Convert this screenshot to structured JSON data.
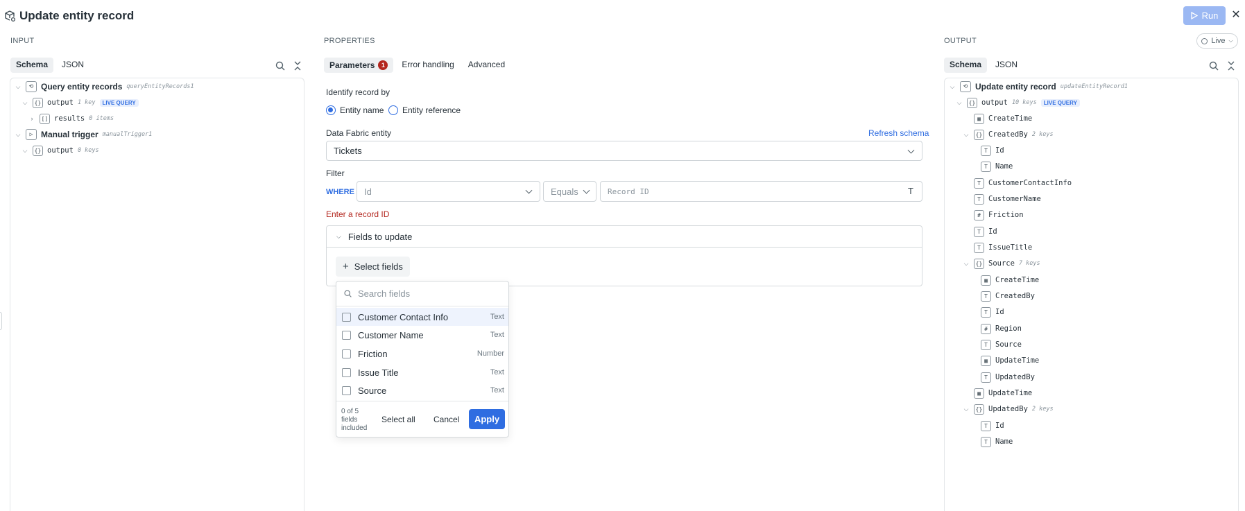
{
  "header": {
    "title": "Update entity record",
    "run_label": "Run",
    "close_icon": "close-icon"
  },
  "input": {
    "label": "INPUT",
    "tabs": [
      "Schema",
      "JSON"
    ],
    "tree": [
      {
        "name": "Query entity records",
        "meta": "queryEntityRecords1",
        "icon": "loop-icon"
      },
      {
        "name": "output",
        "meta": "1 key",
        "badge": "LIVE QUERY"
      },
      {
        "name": "results",
        "meta": "0 items"
      },
      {
        "name": "Manual trigger",
        "meta": "manualTrigger1",
        "icon": "play-icon"
      },
      {
        "name": "output",
        "meta": "0 keys"
      }
    ]
  },
  "properties": {
    "label": "PROPERTIES",
    "tabs": [
      {
        "label": "Parameters",
        "count": "1"
      },
      {
        "label": "Error handling"
      },
      {
        "label": "Advanced"
      }
    ],
    "identify_label": "Identify record by",
    "radio_entity_name": "Entity name",
    "radio_entity_reference": "Entity reference",
    "entity_label": "Data Fabric entity",
    "refresh_label": "Refresh schema",
    "entity_value": "Tickets",
    "filter_label": "Filter",
    "where_label": "WHERE",
    "filter_field_placeholder": "Id",
    "filter_operator": "Equals",
    "record_id_placeholder": "Record ID",
    "error_text": "Enter a record ID",
    "fields_to_update": "Fields to update",
    "select_fields": "Select fields",
    "colors": {
      "accent": "#2f6de1",
      "error": "#b3261e"
    }
  },
  "dropdown": {
    "search_placeholder": "Search fields",
    "items": [
      {
        "label": "Customer Contact Info",
        "type": "Text"
      },
      {
        "label": "Customer Name",
        "type": "Text"
      },
      {
        "label": "Friction",
        "type": "Number"
      },
      {
        "label": "Issue Title",
        "type": "Text"
      },
      {
        "label": "Source",
        "type": "Text"
      }
    ],
    "count_text": "0 of 5 fields included",
    "count_line1": "0 of 5",
    "count_line2": "fields",
    "count_line3": "included",
    "select_all": "Select all",
    "cancel": "Cancel",
    "apply": "Apply"
  },
  "output": {
    "label": "OUTPUT",
    "live_label": "Live",
    "tabs": [
      "Schema",
      "JSON"
    ],
    "tree": [
      {
        "name": "Update entity record",
        "meta": "updateEntityRecord1",
        "icon": "loop-icon"
      },
      {
        "name": "output",
        "meta": "10 keys",
        "badge": "LIVE QUERY"
      },
      {
        "name": "CreateTime",
        "icon": "calendar-icon"
      },
      {
        "name": "CreatedBy",
        "meta": "2 keys",
        "icon": "object-icon"
      },
      {
        "name": "Id",
        "icon": "text-icon"
      },
      {
        "name": "Name",
        "icon": "text-icon"
      },
      {
        "name": "CustomerContactInfo",
        "icon": "text-icon"
      },
      {
        "name": "CustomerName",
        "icon": "text-icon"
      },
      {
        "name": "Friction",
        "icon": "number-icon"
      },
      {
        "name": "Id",
        "icon": "text-icon"
      },
      {
        "name": "IssueTitle",
        "icon": "text-icon"
      },
      {
        "name": "Source",
        "meta": "7 keys",
        "icon": "object-icon"
      },
      {
        "name": "CreateTime",
        "icon": "calendar-icon"
      },
      {
        "name": "CreatedBy",
        "icon": "text-icon"
      },
      {
        "name": "Id",
        "icon": "text-icon"
      },
      {
        "name": "Region",
        "icon": "number-icon"
      },
      {
        "name": "Source",
        "icon": "text-icon"
      },
      {
        "name": "UpdateTime",
        "icon": "calendar-icon"
      },
      {
        "name": "UpdatedBy",
        "icon": "text-icon"
      },
      {
        "name": "UpdateTime",
        "icon": "calendar-icon"
      },
      {
        "name": "UpdatedBy",
        "meta": "2 keys",
        "icon": "object-icon"
      },
      {
        "name": "Id",
        "icon": "text-icon"
      },
      {
        "name": "Name",
        "icon": "text-icon"
      }
    ]
  }
}
